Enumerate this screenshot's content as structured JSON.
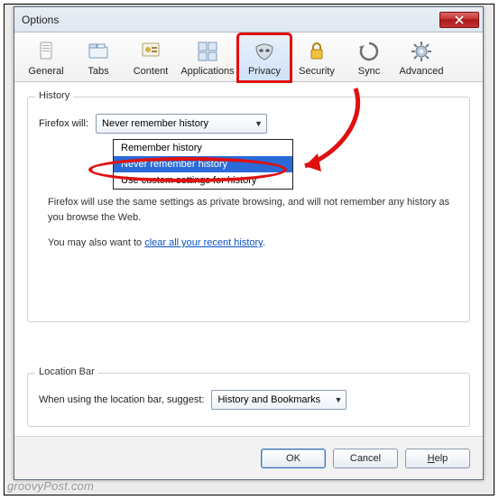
{
  "window": {
    "title": "Options",
    "close_icon": "close"
  },
  "tabs": [
    {
      "id": "general",
      "label": "General",
      "icon": "doc"
    },
    {
      "id": "tabs",
      "label": "Tabs",
      "icon": "tabs"
    },
    {
      "id": "content",
      "label": "Content",
      "icon": "content"
    },
    {
      "id": "applications",
      "label": "Applications",
      "icon": "apps"
    },
    {
      "id": "privacy",
      "label": "Privacy",
      "icon": "mask",
      "selected": true,
      "highlight": true
    },
    {
      "id": "security",
      "label": "Security",
      "icon": "lock"
    },
    {
      "id": "sync",
      "label": "Sync",
      "icon": "sync"
    },
    {
      "id": "advanced",
      "label": "Advanced",
      "icon": "gear"
    }
  ],
  "history": {
    "legend": "History",
    "label": "Firefox will:",
    "combo_value": "Never remember history",
    "options": [
      "Remember history",
      "Never remember history",
      "Use custom settings for history"
    ],
    "selected_index": 1,
    "desc1": "Firefox will use the same settings as private browsing, and will not remember any history as you browse the Web.",
    "desc2_prefix": "You may also want to ",
    "desc2_link": "clear all your recent history",
    "desc2_suffix": "."
  },
  "location": {
    "legend": "Location Bar",
    "label": "When using the location bar, suggest:",
    "combo_value": "History and Bookmarks"
  },
  "buttons": {
    "ok": "OK",
    "cancel": "Cancel",
    "help": "Help"
  },
  "watermark": "groovyPost.com"
}
